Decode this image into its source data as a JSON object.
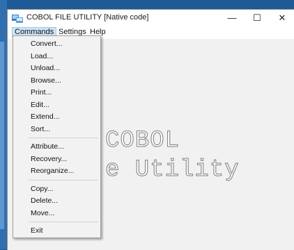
{
  "window": {
    "title": "COBOL FILE UTILITY [Native code]",
    "controls": {
      "minimize": "—",
      "maximize": "☐",
      "close": "✕"
    }
  },
  "menubar": {
    "items": [
      {
        "label": "Commands",
        "active": true
      },
      {
        "label": "Settings"
      },
      {
        "label": "Help"
      }
    ]
  },
  "commands_menu": {
    "groups": [
      [
        "Convert...",
        "Load...",
        "Unload...",
        "Browse...",
        "Print...",
        "Edit...",
        "Extend...",
        "Sort..."
      ],
      [
        "Attribute...",
        "Recovery...",
        "Reorganize..."
      ],
      [
        "Copy...",
        "Delete...",
        "Move..."
      ],
      [
        "Exit"
      ]
    ]
  },
  "banner": {
    "line1": "COBOL",
    "line2": "e Utility"
  }
}
